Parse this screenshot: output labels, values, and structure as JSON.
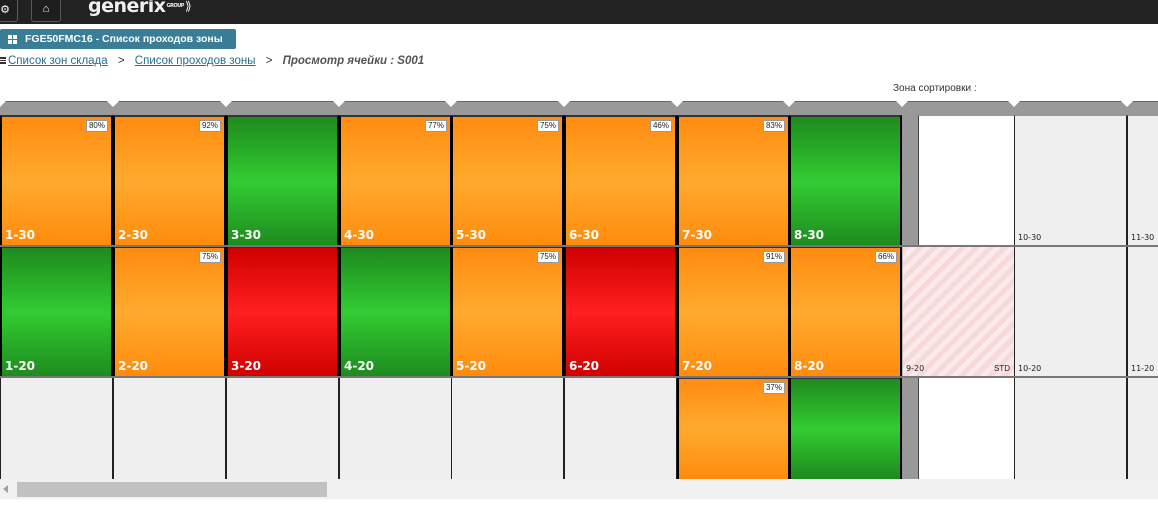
{
  "header": {
    "logo_text": "generix",
    "logo_group": "GROUP",
    "logo_chevron": "⟫",
    "settings_icon": "gear-icon",
    "home_icon": "home-icon"
  },
  "tab": {
    "label": "FGE50FMC16 - Список проходов зоны"
  },
  "breadcrumb": {
    "items": [
      {
        "label": "Список зон склада"
      },
      {
        "label": "Список проходов зоны"
      }
    ],
    "separator": ">",
    "current": "Просмотр ячейки : S001"
  },
  "zone_label": "Зона сортировки :",
  "colors": {
    "orange": "#ff9a1a",
    "green": "#2db82d",
    "red": "#ff1a1a",
    "empty": "#efefef",
    "tab": "#3a7d97"
  },
  "rack": {
    "row30": [
      {
        "label": "1-30",
        "fill": "orange",
        "percent": "80%"
      },
      {
        "label": "2-30",
        "fill": "orange",
        "percent": "92%"
      },
      {
        "label": "3-30",
        "fill": "green",
        "percent": ""
      },
      {
        "label": "4-30",
        "fill": "orange",
        "percent": "77%"
      },
      {
        "label": "5-30",
        "fill": "orange",
        "percent": "75%"
      },
      {
        "label": "6-30",
        "fill": "orange",
        "percent": "46%"
      },
      {
        "label": "7-30",
        "fill": "orange",
        "percent": "83%"
      },
      {
        "label": "8-30",
        "fill": "green",
        "percent": ""
      },
      {
        "label": "",
        "fill": "white",
        "percent": ""
      },
      {
        "label": "10-30",
        "fill": "empty",
        "percent": ""
      },
      {
        "label": "11-30",
        "fill": "empty",
        "percent": ""
      }
    ],
    "row20": [
      {
        "label": "1-20",
        "fill": "green",
        "percent": ""
      },
      {
        "label": "2-20",
        "fill": "orange",
        "percent": "75%"
      },
      {
        "label": "3-20",
        "fill": "red",
        "percent": ""
      },
      {
        "label": "4-20",
        "fill": "green",
        "percent": ""
      },
      {
        "label": "5-20",
        "fill": "orange",
        "percent": "75%"
      },
      {
        "label": "6-20",
        "fill": "red",
        "percent": ""
      },
      {
        "label": "7-20",
        "fill": "orange",
        "percent": "91%"
      },
      {
        "label": "8-20",
        "fill": "orange",
        "percent": "66%"
      },
      {
        "label": "9-20",
        "fill": "hatched",
        "percent": "",
        "tag": "STD"
      },
      {
        "label": "10-20",
        "fill": "empty",
        "percent": ""
      },
      {
        "label": "11-20",
        "fill": "empty",
        "percent": ""
      }
    ],
    "row10": [
      {
        "label": "",
        "fill": "empty",
        "percent": ""
      },
      {
        "label": "",
        "fill": "empty",
        "percent": ""
      },
      {
        "label": "",
        "fill": "empty",
        "percent": ""
      },
      {
        "label": "",
        "fill": "empty",
        "percent": ""
      },
      {
        "label": "",
        "fill": "empty",
        "percent": ""
      },
      {
        "label": "",
        "fill": "empty",
        "percent": ""
      },
      {
        "label": "",
        "fill": "orange",
        "percent": "37%"
      },
      {
        "label": "",
        "fill": "green",
        "percent": ""
      },
      {
        "label": "",
        "fill": "white",
        "percent": ""
      },
      {
        "label": "",
        "fill": "empty",
        "percent": ""
      },
      {
        "label": "",
        "fill": "empty",
        "percent": ""
      }
    ]
  }
}
